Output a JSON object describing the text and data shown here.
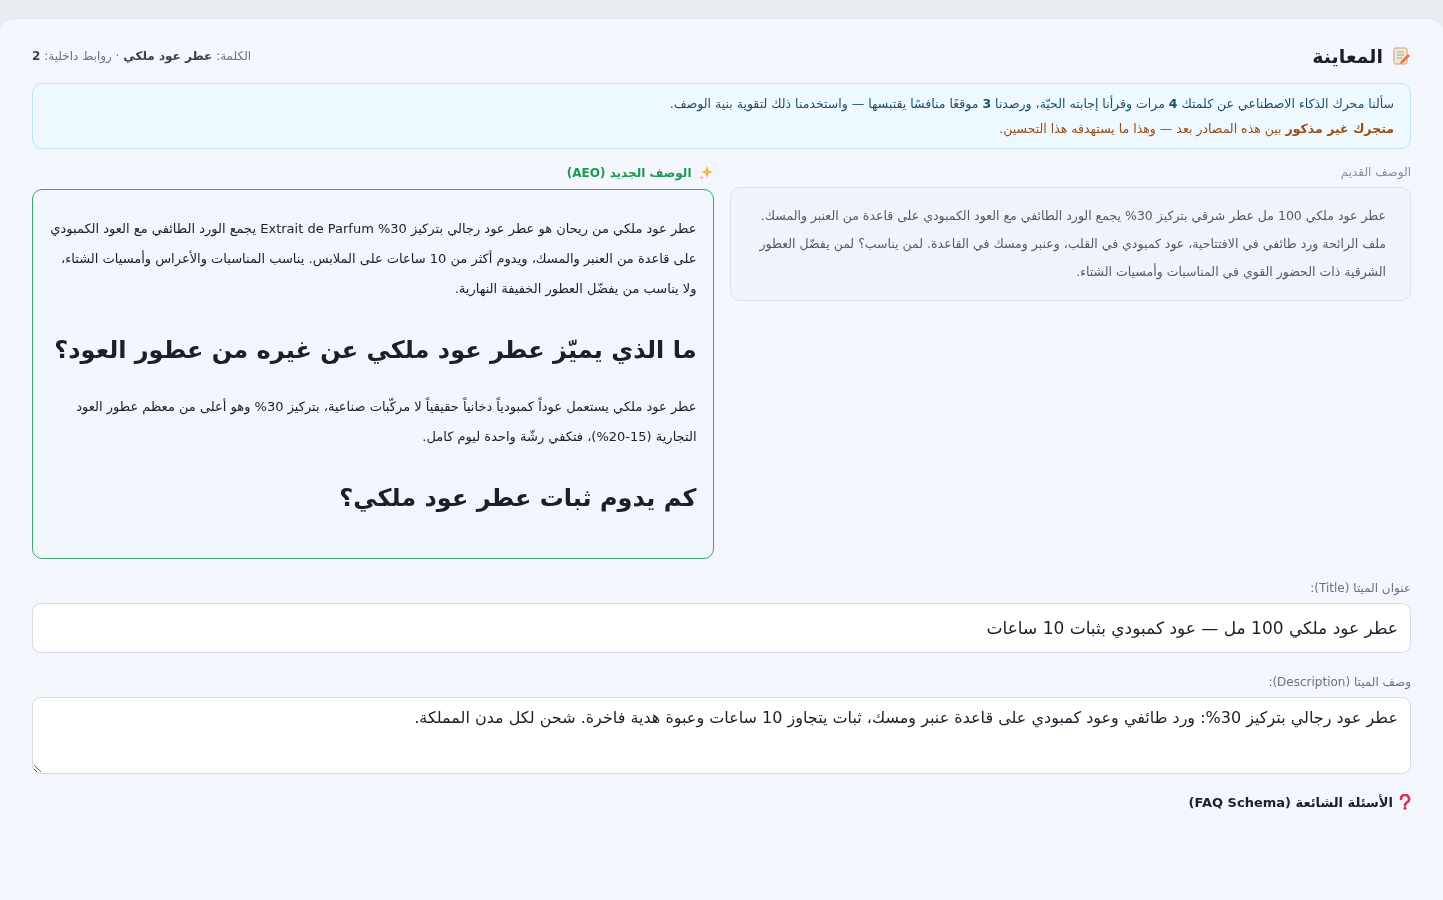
{
  "header": {
    "title": "المعاينة",
    "meta": "الكلمة: **عطر عود ملكي** · روابط داخلية: **2**"
  },
  "notice": {
    "lines": [
      {
        "kind": "info",
        "text": "سألنا محرك الذكاء الاصطناعي عن كلمتك **4** مرات وقرأنا إجابته الحيّة، ورصدنا **3** موقعًا منافسًا يقتبسها — واستخدمنا ذلك لتقوية بنية الوصف."
      },
      {
        "kind": "warning",
        "text": "**متجرك غير مذكور** بين هذه المصادر بعد — وهذا ما يستهدفه هذا التحسين."
      }
    ]
  },
  "old_description": {
    "label": "الوصف القديم",
    "text": "عطر عود ملكي 100 مل عطر شرقي بتركيز 30% يجمع الورد الطائفي مع العود الكمبودي على قاعدة من العنبر والمسك. ملف الرائحة ورد طائفي في الافتتاحية، عود كمبودي في القلب، وعنبر ومسك في القاعدة. لمن يناسب؟ لمن يفضّل العطور الشرقية ذات الحضور القوي في المناسبات وأمسيات الشتاء."
  },
  "new_description": {
    "label": "الوصف الجديد (AEO)",
    "blocks": [
      {
        "kind": "paragraph",
        "text": "عطر عود ملكي من ريحان هو عطر عود رجالي بتركيز 30% Extrait de Parfum يجمع الورد الطائفي مع العود الكمبودي على قاعدة من العنبر والمسك، ويدوم أكثر من 10 ساعات على الملابس. يناسب المناسبات والأعراس وأمسيات الشتاء، ولا يناسب من يفضّل العطور الخفيفة النهارية."
      },
      {
        "kind": "heading",
        "text": "ما الذي يميّز عطر عود ملكي عن غيره من عطور العود؟"
      },
      {
        "kind": "paragraph",
        "text": "عطر عود ملكي يستعمل عوداً كمبودياً دخانياً حقيقياً لا مركّبات صناعية، بتركيز 30% وهو أعلى من معظم عطور العود التجارية (15-20%)، فتكفي رشّة واحدة ليوم كامل."
      },
      {
        "kind": "heading",
        "text": "كم يدوم ثبات عطر عود ملكي؟"
      }
    ]
  },
  "meta_title": {
    "label": "عنوان الميتا (Title):",
    "value": "عطر عود ملكي 100 مل — عود كمبودي بثبات 10 ساعات"
  },
  "meta_description": {
    "label": "وصف الميتا (Description):",
    "value": "عطر عود رجالي بتركيز 30%: ورد طائفي وعود كمبودي على قاعدة عنبر ومسك، ثبات يتجاوز 10 ساعات وعبوة هدية فاخرة. شحن لكل مدن المملكة."
  },
  "faq": {
    "title": "الأسئلة الشائعة (FAQ Schema)"
  }
}
